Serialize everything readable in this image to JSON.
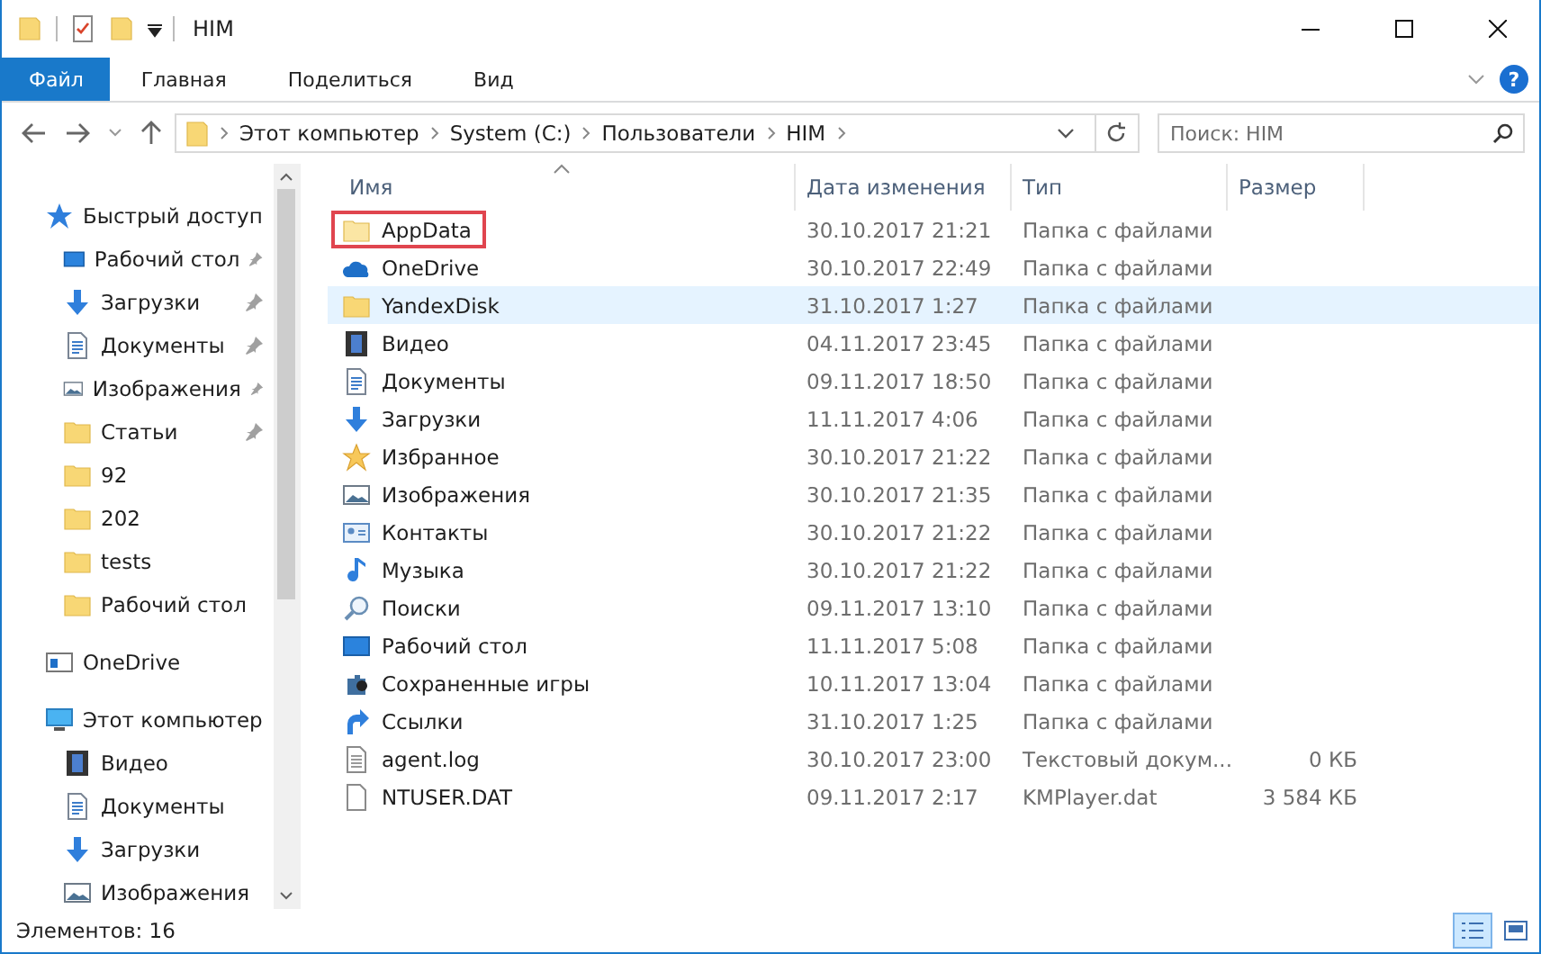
{
  "window": {
    "title": "HIM",
    "help": "?"
  },
  "ribbon_tabs": [
    {
      "label": "Файл",
      "kind": "file",
      "selected": true
    },
    {
      "label": "Главная",
      "kind": "tab",
      "selected": false
    },
    {
      "label": "Поделиться",
      "kind": "tab",
      "selected": false
    },
    {
      "label": "Вид",
      "kind": "tab",
      "selected": false
    }
  ],
  "address_bar": {
    "path": [
      "Этот компьютер",
      "System (C:)",
      "Пользователи",
      "HIM"
    ]
  },
  "search": {
    "placeholder": "Поиск: HIM"
  },
  "sidebar": {
    "items": [
      {
        "label": "Быстрый доступ",
        "kind": "quick",
        "children": [
          {
            "label": "Рабочий стол",
            "kind": "desktop",
            "pinned": true
          },
          {
            "label": "Загрузки",
            "kind": "download",
            "pinned": true
          },
          {
            "label": "Документы",
            "kind": "docs",
            "pinned": true
          },
          {
            "label": "Изображения",
            "kind": "images",
            "pinned": true
          },
          {
            "label": "Статьи",
            "kind": "folder",
            "pinned": true
          },
          {
            "label": "92",
            "kind": "folder",
            "pinned": false
          },
          {
            "label": "202",
            "kind": "folder",
            "pinned": false
          },
          {
            "label": "tests",
            "kind": "folder",
            "pinned": false
          },
          {
            "label": "Рабочий стол",
            "kind": "folder",
            "pinned": false
          }
        ]
      },
      {
        "label": "OneDrive",
        "kind": "onedrive-side"
      },
      {
        "label": "Этот компьютер",
        "kind": "pc",
        "children": [
          {
            "label": "Видео",
            "kind": "video",
            "pinned": false
          },
          {
            "label": "Документы",
            "kind": "docs",
            "pinned": false
          },
          {
            "label": "Загрузки",
            "kind": "download",
            "pinned": false
          },
          {
            "label": "Изображения",
            "kind": "images",
            "pinned": false
          }
        ]
      }
    ]
  },
  "table": {
    "columns": [
      {
        "label": "Имя",
        "sorted": true
      },
      {
        "label": "Дата изменения",
        "sorted": false
      },
      {
        "label": "Тип",
        "sorted": false
      },
      {
        "label": "Размер",
        "sorted": false
      }
    ],
    "rows": [
      {
        "name": "AppData",
        "date": "30.10.2017 21:21",
        "type": "Папка с файлами",
        "kind": "folder-light",
        "selected": false,
        "annotated": true
      },
      {
        "name": "OneDrive",
        "date": "30.10.2017 22:49",
        "type": "Папка с файлами",
        "kind": "onedrive",
        "selected": false,
        "annotated": false
      },
      {
        "name": "YandexDisk",
        "date": "31.10.2017 1:27",
        "type": "Папка с файлами",
        "kind": "folder",
        "selected": true,
        "annotated": false
      },
      {
        "name": "Видео",
        "date": "04.11.2017 23:45",
        "type": "Папка с файлами",
        "kind": "video",
        "selected": false,
        "annotated": false
      },
      {
        "name": "Документы",
        "date": "09.11.2017 18:50",
        "type": "Папка с файлами",
        "kind": "docs",
        "selected": false,
        "annotated": false
      },
      {
        "name": "Загрузки",
        "date": "11.11.2017 4:06",
        "type": "Папка с файлами",
        "kind": "download",
        "selected": false,
        "annotated": false
      },
      {
        "name": "Избранное",
        "date": "30.10.2017 21:22",
        "type": "Папка с файлами",
        "kind": "star",
        "selected": false,
        "annotated": false
      },
      {
        "name": "Изображения",
        "date": "30.10.2017 21:35",
        "type": "Папка с файлами",
        "kind": "images",
        "selected": false,
        "annotated": false
      },
      {
        "name": "Контакты",
        "date": "30.10.2017 21:22",
        "type": "Папка с файлами",
        "kind": "contacts",
        "selected": false,
        "annotated": false
      },
      {
        "name": "Музыка",
        "date": "30.10.2017 21:22",
        "type": "Папка с файлами",
        "kind": "music",
        "selected": false,
        "annotated": false
      },
      {
        "name": "Поиски",
        "date": "09.11.2017 13:10",
        "type": "Папка с файлами",
        "kind": "searches",
        "selected": false,
        "annotated": false
      },
      {
        "name": "Рабочий стол",
        "date": "11.11.2017 5:08",
        "type": "Папка с файлами",
        "kind": "desktop",
        "selected": false,
        "annotated": false
      },
      {
        "name": "Сохраненные игры",
        "date": "10.11.2017 13:04",
        "type": "Папка с файлами",
        "kind": "games",
        "selected": false,
        "annotated": false
      },
      {
        "name": "Ссылки",
        "date": "31.10.2017 1:25",
        "type": "Папка с файлами",
        "kind": "links",
        "selected": false,
        "annotated": false
      },
      {
        "name": "agent.log",
        "date": "30.10.2017 23:00",
        "type": "Текстовый докум...",
        "size": "0 КБ",
        "kind": "text",
        "selected": false,
        "annotated": false
      },
      {
        "name": "NTUSER.DAT",
        "date": "09.11.2017 2:17",
        "type": "KMPlayer.dat",
        "size": "3 584 КБ",
        "kind": "file",
        "selected": false,
        "annotated": false
      }
    ]
  },
  "status_bar": {
    "count": "Элементов: 16",
    "views": [
      {
        "kind": "details",
        "selected": true
      },
      {
        "kind": "tiles",
        "selected": false
      }
    ]
  }
}
